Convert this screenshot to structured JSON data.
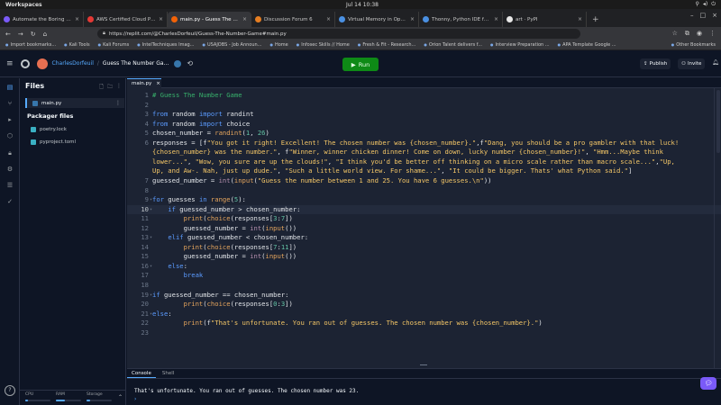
{
  "os": {
    "workspaces": "Workspaces",
    "clock": "Jul 14  10:38",
    "tray": [
      "⚲",
      "◂)",
      "⏻"
    ]
  },
  "browser": {
    "tabs": [
      {
        "title": "Automate the Boring Stuff w",
        "color": "#7a5af8"
      },
      {
        "title": "AWS Certified Cloud Practiti",
        "color": "#e53935"
      },
      {
        "title": "main.py - Guess The Numbe",
        "color": "#f26207",
        "active": true
      },
      {
        "title": "Discussion Forum 6",
        "color": "#e67e22"
      },
      {
        "title": "Virtual Memory in Operatin",
        "color": "#4a90e2"
      },
      {
        "title": "Thonny, Python IDE for beg",
        "color": "#4a90e2"
      },
      {
        "title": "art · PyPI",
        "color": "#e8e8e8"
      }
    ],
    "new_tab": "+",
    "url": "https://replit.com/@CharlesDorfeuil/Guess-The-Number-Game#main.py",
    "bookmarks": [
      "Import bookmarks...",
      "Kali Tools",
      "Kali Forums",
      "IntelTechniques Imag...",
      "USAJOBS - Job Announ...",
      "Home",
      "Infosec Skills // Home",
      "Fresh & Fit - Research...",
      "Orion Talent delivers f...",
      "Interview Preparation ...",
      "APA Template Google ..."
    ],
    "other_bookmarks": "Other Bookmarks"
  },
  "header": {
    "user": "CharlesDorfeuil",
    "repl_name": "Guess The Number Ga...",
    "run_label": "Run",
    "publish_label": "Publish",
    "invite_label": "Invite"
  },
  "files": {
    "title": "Files",
    "main_file": "main.py",
    "packager_title": "Packager files",
    "packager": [
      "poetry.lock",
      "pyproject.toml"
    ],
    "resources": {
      "cpu": "CPU",
      "ram": "RAM",
      "storage": "Storage"
    },
    "resource_levels": {
      "cpu": 0.1,
      "ram": 0.35,
      "storage": 0.15
    }
  },
  "editor": {
    "tab": "main.py",
    "active_line": 10
  },
  "console": {
    "tabs": [
      "Console",
      "Shell"
    ],
    "output": "That's unfortunate. You ran out of guesses. The chosen number was 23.",
    "prompt": "›"
  }
}
